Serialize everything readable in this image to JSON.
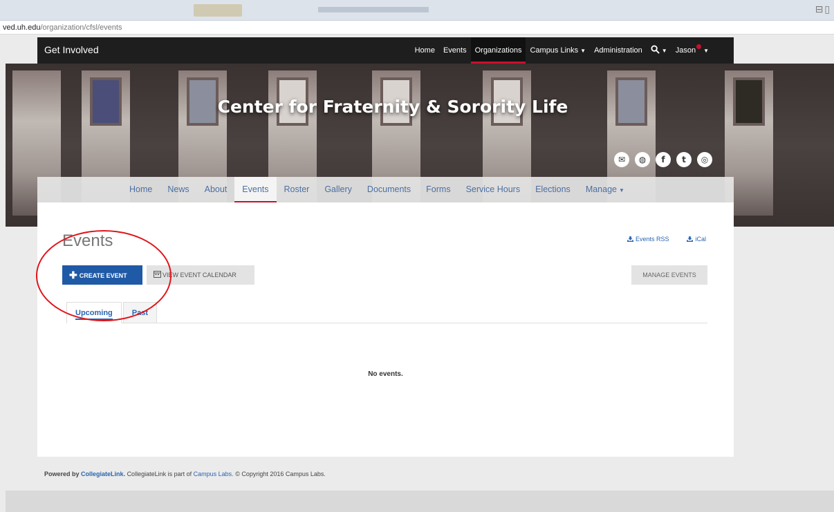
{
  "browser": {
    "url_host": "ved.uh.edu",
    "url_path": "/organization/cfsl/events"
  },
  "topnav": {
    "brand": "Get Involved",
    "items": [
      "Home",
      "Events",
      "Organizations",
      "Campus Links",
      "Administration"
    ],
    "active": "Organizations",
    "user": "Jason"
  },
  "banner": {
    "title": "Center for Fraternity & Sorority Life",
    "social": [
      "mail-icon",
      "globe-icon",
      "facebook-icon",
      "twitter-icon",
      "instagram-icon"
    ]
  },
  "subnav": {
    "items": [
      "Home",
      "News",
      "About",
      "Events",
      "Roster",
      "Gallery",
      "Documents",
      "Forms",
      "Service Hours",
      "Elections",
      "Manage"
    ],
    "active": "Events"
  },
  "main": {
    "title": "Events",
    "links": {
      "rss": "Events RSS",
      "ical": "iCal"
    },
    "buttons": {
      "create": "CREATE EVENT",
      "calendar": "VIEW EVENT CALENDAR",
      "manage": "MANAGE EVENTS"
    },
    "tabs": [
      "Upcoming",
      "Past"
    ],
    "empty": "No events."
  },
  "footer": {
    "powered_prefix": "Powered by",
    "powered_link": "CollegiateLink.",
    "text_mid": "CollegiateLink is part of",
    "campus_labs": "Campus Labs.",
    "copyright": "© Copyright 2016 Campus Labs."
  },
  "colors": {
    "accent": "#c8102e",
    "link": "#2a64b0",
    "primary_button": "#1f5aa6",
    "annotation": "#e0141a"
  }
}
